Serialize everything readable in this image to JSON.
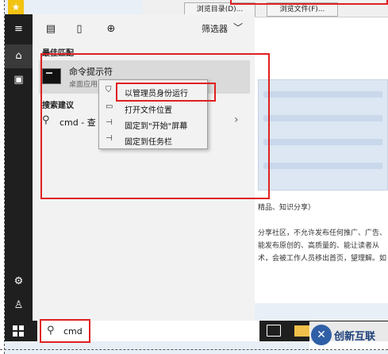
{
  "background_window": {
    "buttons": [
      "浏览目录(D)...",
      "浏览文件(F)..."
    ],
    "text_lines": [
      "精品、知识分享）",
      "分享社区，不允许发布任何推广、广告、",
      "能发布原创的、高质量的、能让读者从",
      "术，会被工作人员移出首页，望理解。如"
    ]
  },
  "rail": {
    "items": [
      {
        "icon": "hamburger-icon"
      },
      {
        "icon": "home-icon"
      },
      {
        "icon": "documents-icon"
      },
      {
        "icon": "settings-icon"
      },
      {
        "icon": "user-icon"
      }
    ]
  },
  "filter_bar": {
    "icons": [
      "apps-icon",
      "document-icon",
      "web-icon"
    ],
    "filter_label": "筛选器"
  },
  "best_match": {
    "header": "最佳匹配",
    "title": "命令提示符",
    "subtitle": "桌面应用"
  },
  "suggestions": {
    "header": "搜索建议",
    "item": "cmd - 查"
  },
  "context_menu": {
    "items": [
      {
        "label": "以管理员身份运行",
        "icon": "admin-shield-icon"
      },
      {
        "label": "打开文件位置",
        "icon": "folder-open-icon"
      },
      {
        "label": "固定到\"开始\"屏幕",
        "icon": "pin-start-icon"
      },
      {
        "label": "固定到任务栏",
        "icon": "pin-taskbar-icon"
      }
    ]
  },
  "taskbar": {
    "search_text": "cmd"
  },
  "watermark": {
    "text": "创新互联"
  },
  "annotation_color": "#e02020"
}
